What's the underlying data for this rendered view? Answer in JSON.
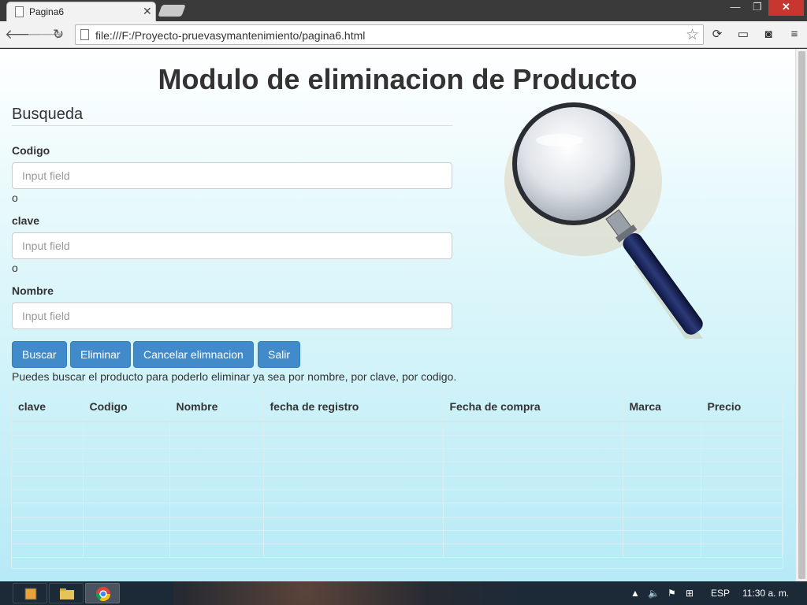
{
  "browser": {
    "tab_title": "Pagina6",
    "url": "file:///F:/Proyecto-pruevasymantenimiento/pagina6.html"
  },
  "page": {
    "title": "Modulo de eliminacion de Producto",
    "section_title": "Busqueda",
    "fields": [
      {
        "label": "Codigo",
        "placeholder": "Input field"
      },
      {
        "label": "clave",
        "placeholder": "Input field"
      },
      {
        "label": "Nombre",
        "placeholder": "Input field"
      }
    ],
    "or_text": "o",
    "buttons": {
      "buscar": "Buscar",
      "eliminar": "Eliminar",
      "cancelar": "Cancelar elimnacion",
      "salir": "Salir"
    },
    "help_text": "Puedes buscar el producto para poderlo eliminar ya sea por nombre, por clave, por codigo.",
    "table": {
      "headers": [
        "clave",
        "Codigo",
        "Nombre",
        "fecha de registro",
        "Fecha de compra",
        "Marca",
        "Precio"
      ]
    },
    "magnifier_image": "magnifying-glass"
  },
  "taskbar": {
    "language": "ESP",
    "time": "11:30 a. m."
  },
  "colors": {
    "primary_button": "#428bca",
    "close_button": "#c7372f",
    "page_gradient_bottom": "#b6eaf6"
  }
}
